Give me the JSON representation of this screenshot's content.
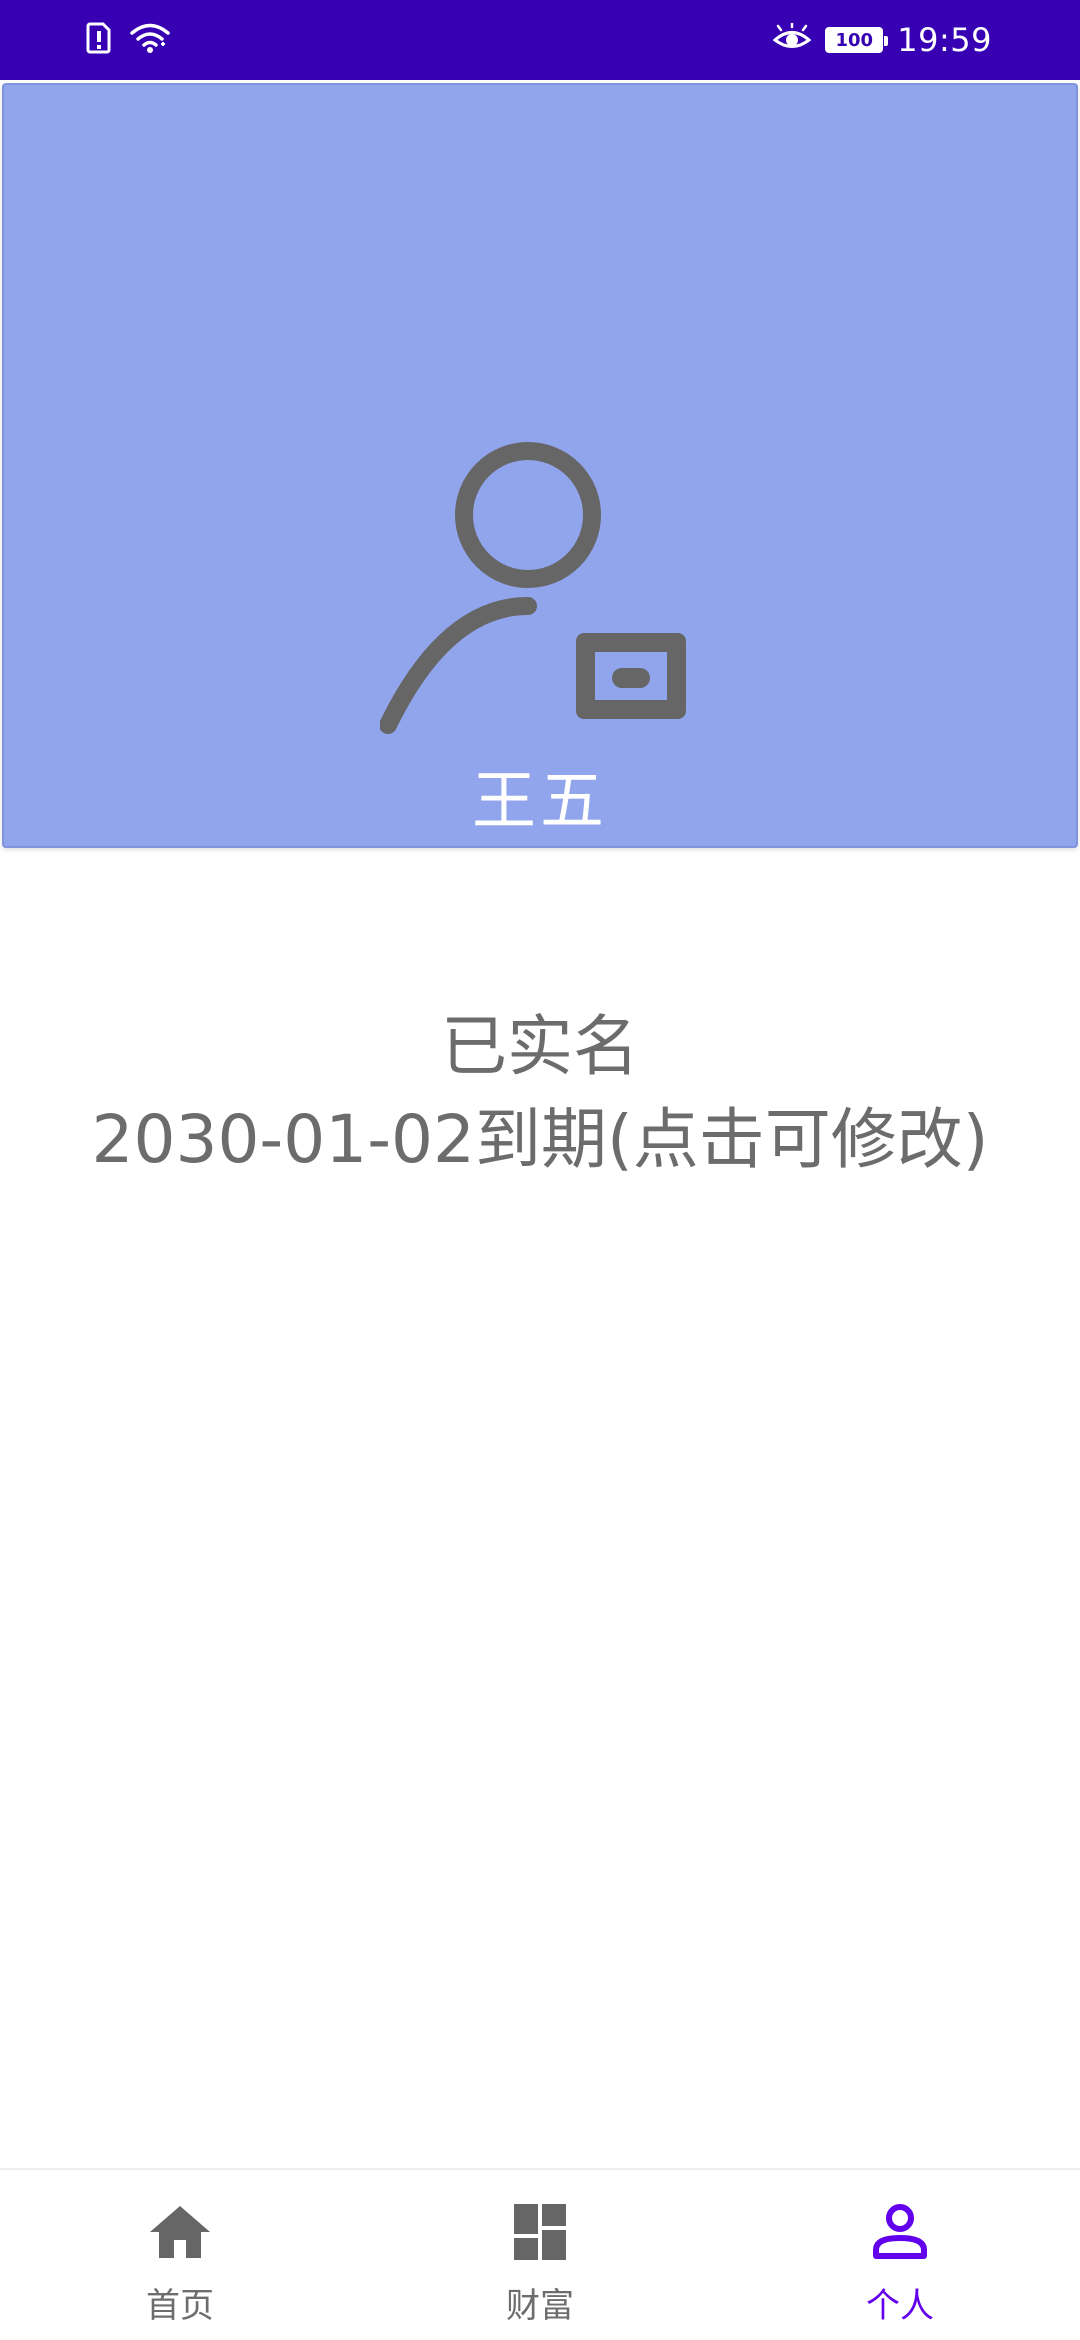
{
  "status_bar": {
    "time": "19:59",
    "battery_level": "100",
    "icons": [
      "sim-alert-icon",
      "wifi-icon",
      "eye-icon",
      "battery-icon"
    ]
  },
  "profile": {
    "name": "王五",
    "avatar_icon": "user-id-card-icon"
  },
  "verification": {
    "status": "已实名",
    "expire_text": "2030-01-02到期(点击可修改)"
  },
  "bottom_nav": {
    "items": [
      {
        "label": "首页",
        "icon": "home-icon",
        "active": false
      },
      {
        "label": "财富",
        "icon": "dashboard-icon",
        "active": false
      },
      {
        "label": "个人",
        "icon": "person-icon",
        "active": true
      }
    ]
  },
  "colors": {
    "status_bar": "#3700B3",
    "header_bg": "#91A5EC",
    "text_gray": "#6c6c6c",
    "active": "#6200EE"
  }
}
